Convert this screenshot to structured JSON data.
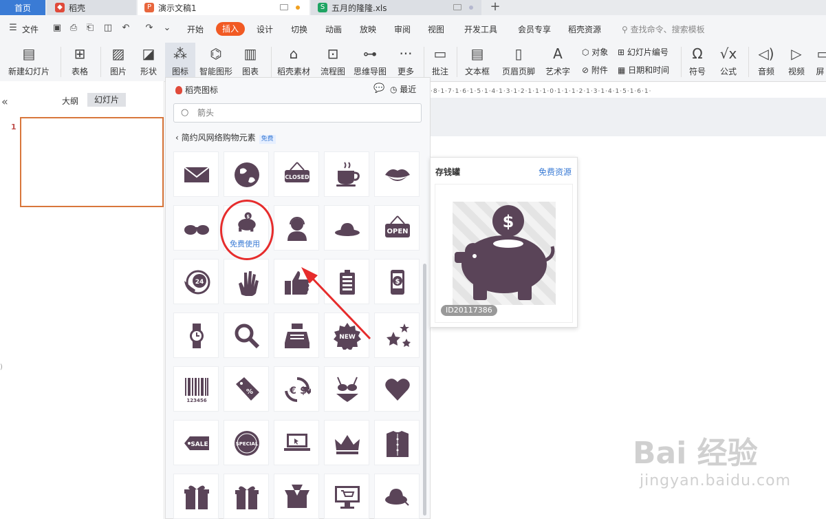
{
  "tabs": {
    "home": "首页",
    "daoke": "稻壳",
    "ppt": "演示文稿1",
    "xls": "五月的隆隆.xls",
    "add": "+"
  },
  "menu": {
    "file": "文件",
    "items": [
      "开始",
      "插入",
      "设计",
      "切换",
      "动画",
      "放映",
      "审阅",
      "视图",
      "开发工具",
      "会员专享",
      "稻壳资源"
    ],
    "search_placeholder": "查找命令、搜索模板"
  },
  "ribbon": {
    "new_slide": "新建幻灯片",
    "table": "表格",
    "picture": "图片",
    "shape": "形状",
    "icon": "图标",
    "smart_art": "智能图形",
    "chart": "图表",
    "daoke_material": "稻壳素材",
    "flowchart": "流程图",
    "mindmap": "思维导图",
    "more": "更多",
    "comment": "批注",
    "textbox": "文本框",
    "header_footer": "页眉页脚",
    "wordart": "艺术字",
    "object": "对象",
    "attachment": "附件",
    "slide_number": "幻灯片编号",
    "date_time": "日期和时间",
    "symbol": "符号",
    "formula": "公式",
    "audio": "音频",
    "video": "视频",
    "screen": "屏"
  },
  "left_panel": {
    "outline_tab": "大纲",
    "slides_tab": "幻灯片",
    "slide_number": "1"
  },
  "ruler_text": "·8·1·7·1·6·1·5·1·4·1·3·1·2·1·1·1·0·1·1·1·2·1·3·1·4·1·5·1·6·1·",
  "icon_panel": {
    "title": "稻壳图标",
    "recent": "最近",
    "search_placeholder": "箭头",
    "category": "简约风网络购物元素",
    "free_badge": "免费",
    "hover_label": "免费使用",
    "icons": [
      "envelope-icon",
      "globe-icon",
      "closed-sign-icon",
      "coffee-cup-icon",
      "lips-icon",
      "sunglasses-icon",
      "piggy-bank-icon",
      "customer-service-icon",
      "sun-hat-icon",
      "open-sign-icon",
      "phone-24-icon",
      "glove-icon",
      "thumbs-up-icon",
      "battery-icon",
      "mobile-dollar-icon",
      "wristwatch-icon",
      "magnifier-icon",
      "cash-register-icon",
      "new-badge-icon",
      "stars-icon",
      "barcode-icon",
      "percent-tag-icon",
      "currency-exchange-icon",
      "bikini-icon",
      "heart-icon",
      "sale-tag-icon",
      "special-badge-icon",
      "laptop-icon",
      "crown-icon",
      "shirt-icon",
      "gift-box-icon",
      "gift-icon",
      "open-box-icon",
      "online-shop-icon",
      "lady-hat-icon"
    ],
    "labels": {
      "closed": "CLOSED",
      "open": "OPEN",
      "new": "NEW",
      "sale": "SALE",
      "special": "SPECIAL",
      "barcode": "123456",
      "percent": "%",
      "phone": "24"
    }
  },
  "preview": {
    "title": "存钱罐",
    "free_resource": "免费资源",
    "id": "ID20117386"
  },
  "watermark": {
    "logo": "Bai 经验",
    "url": "jingyan.baidu.com"
  },
  "colors": {
    "accent": "#f15a24",
    "icon_fill": "#5a4458",
    "link": "#3a7bd5",
    "highlight_red": "#e62c2c"
  }
}
